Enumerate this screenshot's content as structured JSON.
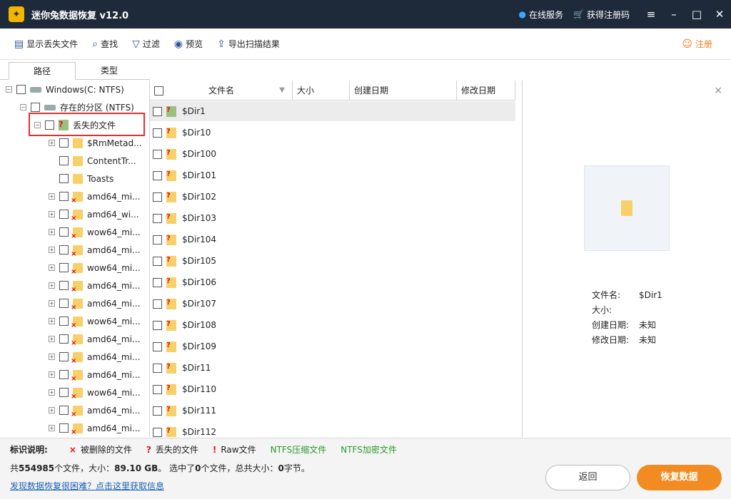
{
  "titlebar": {
    "logo_glyph": "✦",
    "title": "迷你兔数据恢复 v12.0",
    "online_service": "在线服务",
    "get_code": "获得注册码",
    "menu_icon": "≡",
    "min_icon": "–",
    "max_icon": "□",
    "close_icon": "✕"
  },
  "toolbar": {
    "show_lost": "显示丢失文件",
    "find": "查找",
    "filter": "过滤",
    "preview": "预览",
    "export": "导出扫描结果",
    "register": "注册"
  },
  "tabs": {
    "path": "路径",
    "type": "类型"
  },
  "tree": {
    "root": "Windows(C: NTFS)",
    "partition": "存在的分区 (NTFS)",
    "lost": "丢失的文件",
    "items": [
      "$RmMetad...",
      "ContentTr...",
      "Toasts",
      "amd64_mi...",
      "amd64_wi...",
      "wow64_mi...",
      "amd64_mi...",
      "wow64_mi...",
      "amd64_mi...",
      "amd64_mi...",
      "wow64_mi...",
      "amd64_mi...",
      "amd64_mi...",
      "amd64_mi...",
      "wow64_mi...",
      "amd64_mi...",
      "amd64_mi..."
    ]
  },
  "filelist": {
    "headers": {
      "name": "文件名",
      "size": "大小",
      "created": "创建日期",
      "modified": "修改日期"
    },
    "rows": [
      "$Dir1",
      "$Dir10",
      "$Dir100",
      "$Dir101",
      "$Dir102",
      "$Dir103",
      "$Dir104",
      "$Dir105",
      "$Dir106",
      "$Dir107",
      "$Dir108",
      "$Dir109",
      "$Dir11",
      "$Dir110",
      "$Dir111",
      "$Dir112"
    ]
  },
  "preview": {
    "close": "×",
    "name_label": "文件名:",
    "name_value": "$Dir1",
    "size_label": "大小:",
    "size_value": "",
    "created_label": "创建日期:",
    "created_value": "未知",
    "modified_label": "修改日期:",
    "modified_value": "未知"
  },
  "legend": {
    "label": "标识说明:",
    "deleted_mark": "×",
    "deleted": "被删除的文件",
    "lost_mark": "?",
    "lost": "丢失的文件",
    "raw_mark": "!",
    "raw": "Raw文件",
    "ntfs_comp": "NTFS压缩文件",
    "ntfs_enc": "NTFS加密文件"
  },
  "summary": {
    "prefix": "共",
    "total_files": "554985",
    "files_suffix": "个文件，大小：",
    "total_size": "89.10 GB",
    "selected_prefix": "。 选中了",
    "selected_count": "0",
    "selected_mid": "个文件，总共大小：",
    "selected_size": "0",
    "selected_suffix": "字节。"
  },
  "help_link": "发现数据恢复很困难？点击这里获取信息",
  "buttons": {
    "back": "返回",
    "recover": "恢复数据"
  }
}
